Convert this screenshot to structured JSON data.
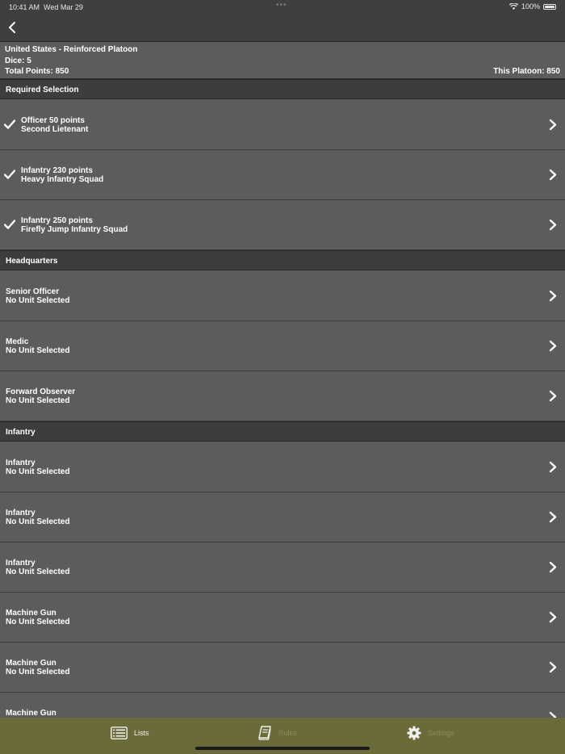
{
  "status": {
    "time": "10:41 AM",
    "date": "Wed Mar 29",
    "battery": "100%"
  },
  "header": {
    "title": "United States - Reinforced Platoon",
    "dice": "Dice: 5",
    "total_points": "Total Points: 850",
    "this_platoon": "This Platoon: 850"
  },
  "sections": {
    "required": "Required Selection",
    "headquarters": "Headquarters",
    "infantry": "Infantry"
  },
  "required_rows": [
    {
      "line1": "Officer  50 points",
      "line2": "Second Lietenant"
    },
    {
      "line1": "Infantry  230 points",
      "line2": "Heavy Infantry Squad"
    },
    {
      "line1": "Infantry  250 points",
      "line2": "Firefly Jump Infantry Squad"
    }
  ],
  "hq_rows": [
    {
      "line1": "Senior Officer",
      "line2": "No Unit Selected"
    },
    {
      "line1": "Medic",
      "line2": "No Unit Selected"
    },
    {
      "line1": "Forward Observer",
      "line2": "No Unit Selected"
    }
  ],
  "infantry_rows": [
    {
      "line1": "Infantry",
      "line2": "No Unit Selected"
    },
    {
      "line1": "Infantry",
      "line2": "No Unit Selected"
    },
    {
      "line1": "Infantry",
      "line2": "No Unit Selected"
    },
    {
      "line1": "Machine Gun",
      "line2": "No Unit Selected"
    },
    {
      "line1": "Machine Gun",
      "line2": "No Unit Selected"
    },
    {
      "line1": "Machine Gun",
      "line2": ""
    }
  ],
  "tabs": {
    "lists": "Lists",
    "rules": "Rules",
    "settings": "Settings"
  },
  "colors": {
    "tab_bar": "#6b6b3a",
    "section_header": "#3d3d3d",
    "row_bg": "#5c5c5c"
  }
}
